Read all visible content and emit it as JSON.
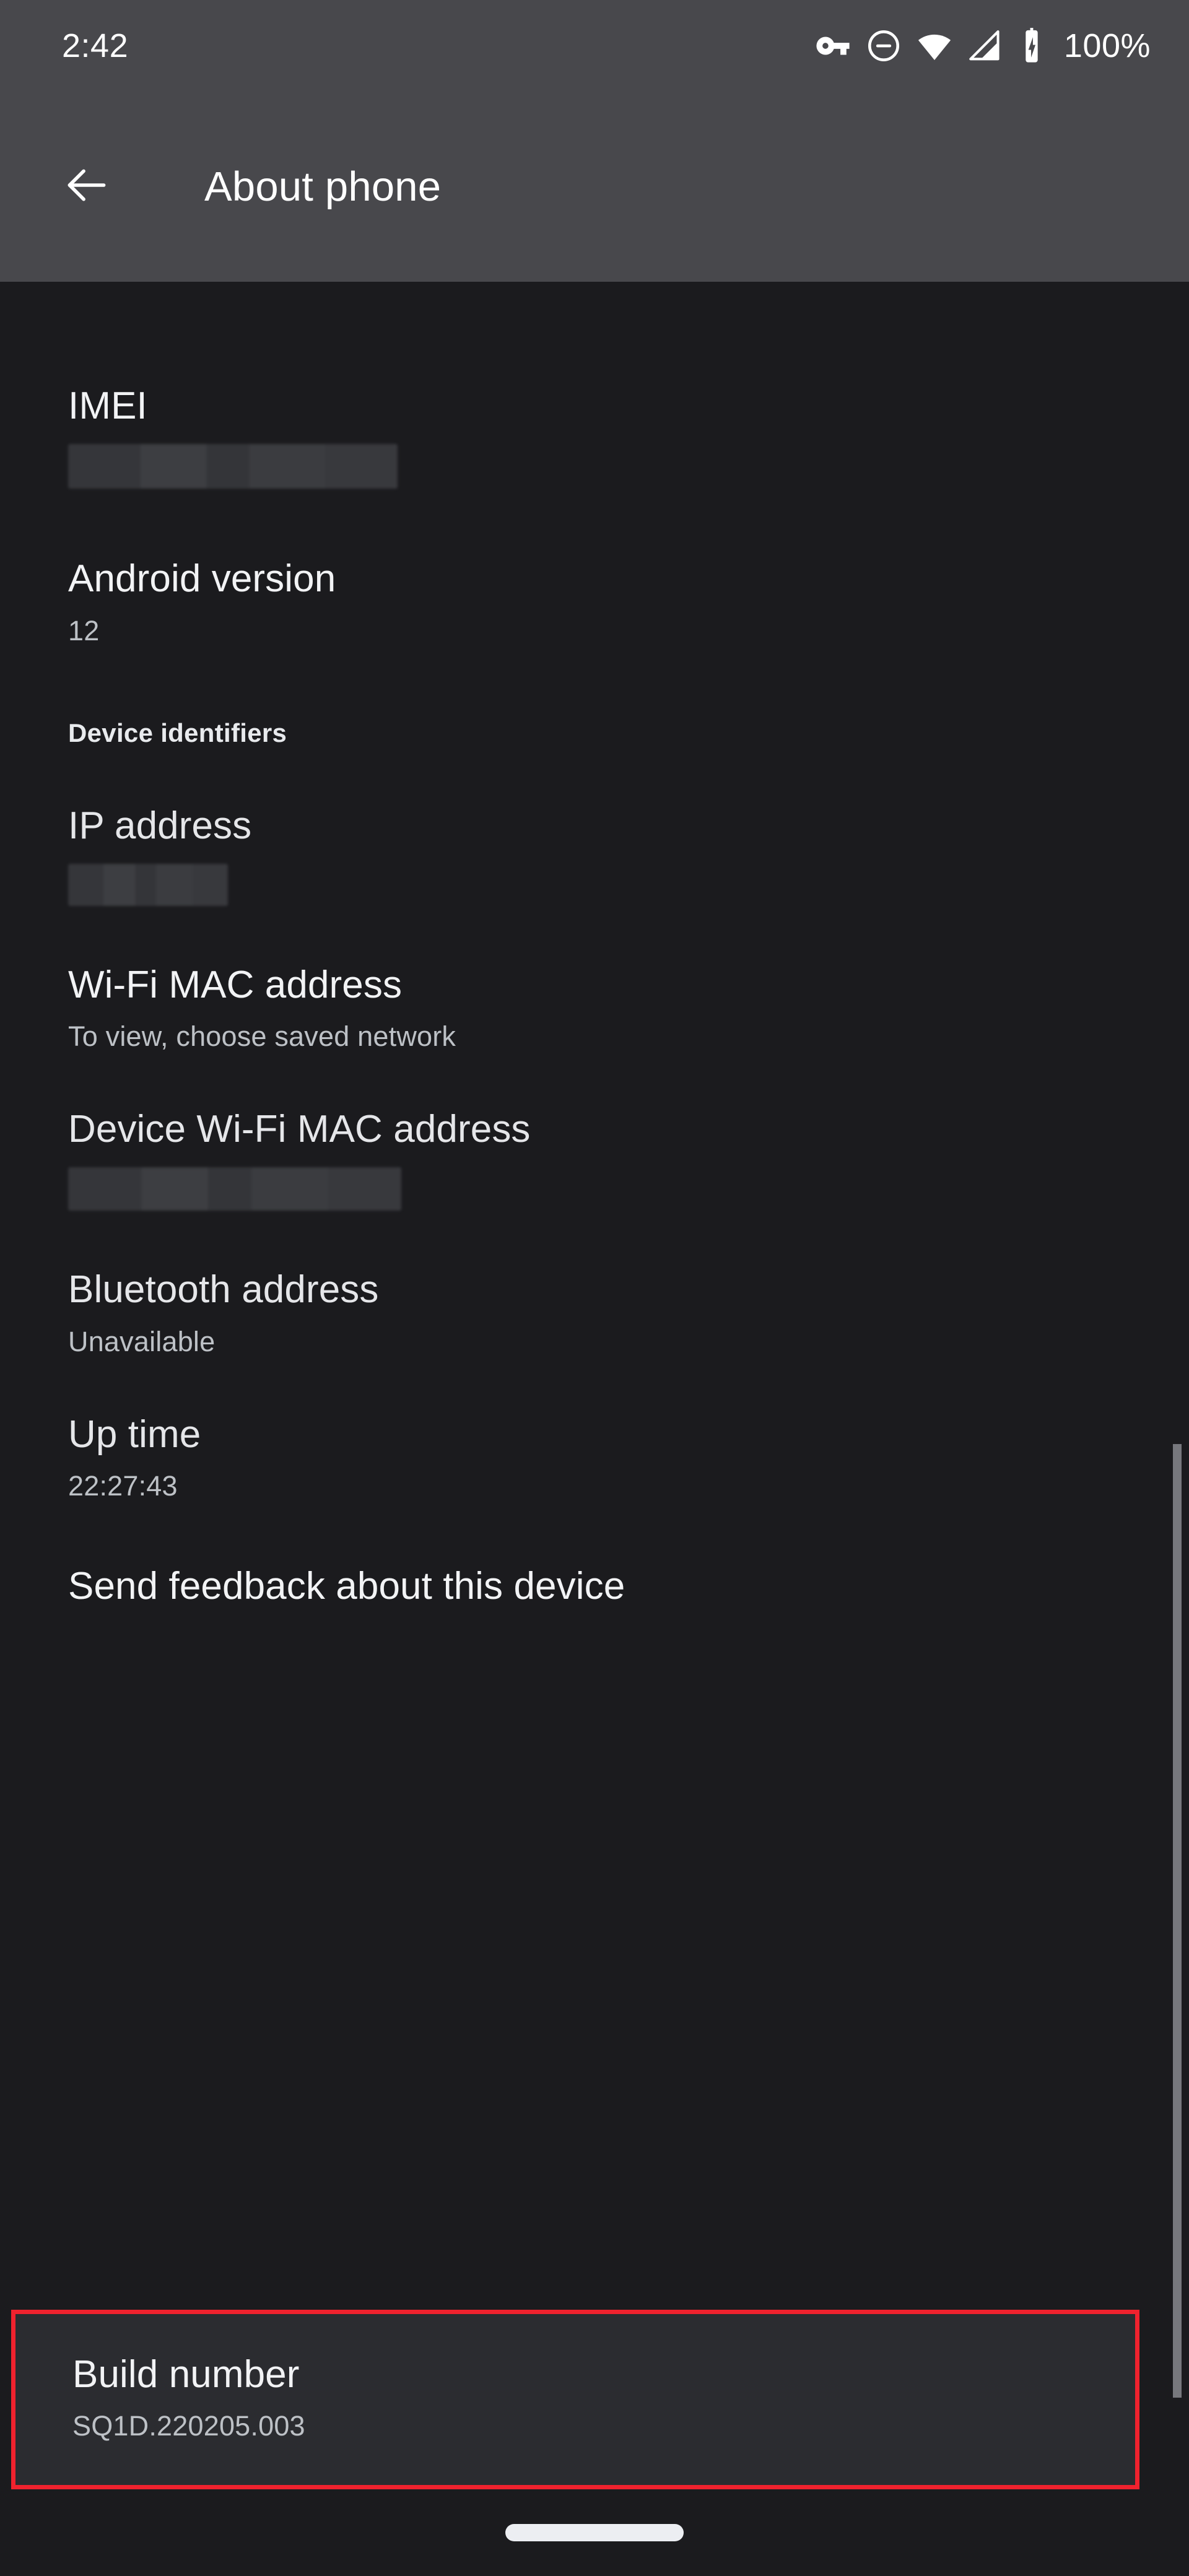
{
  "status_bar": {
    "time": "2:42",
    "battery_percent": "100%",
    "icons": [
      "vpn-key-icon",
      "do-not-disturb-icon",
      "wifi-icon",
      "cellular-signal-icon",
      "battery-charging-icon"
    ]
  },
  "app_bar": {
    "title": "About phone",
    "back_icon": "arrow-back-icon"
  },
  "settings": {
    "imei": {
      "title": "IMEI",
      "value": ""
    },
    "android_version": {
      "title": "Android version",
      "value": "12"
    },
    "device_identifiers_header": "Device identifiers",
    "ip_address": {
      "title": "IP address",
      "value": ""
    },
    "wifi_mac_address": {
      "title": "Wi-Fi MAC address",
      "value": "To view, choose saved network"
    },
    "device_wifi_mac_address": {
      "title": "Device Wi-Fi MAC address",
      "value": ""
    },
    "bluetooth_address": {
      "title": "Bluetooth address",
      "value": "Unavailable"
    },
    "up_time": {
      "title": "Up time",
      "value": "22:27:43"
    },
    "send_feedback": {
      "title": "Send feedback about this device"
    },
    "build_number": {
      "title": "Build number",
      "value": "SQ1D.220205.003"
    }
  },
  "colors": {
    "appbar_background": "#48484c",
    "content_background": "#1b1b1e",
    "highlight_border": "#f0222e",
    "highlight_fill": "#2b2c30",
    "primary_text": "#e5e6e9",
    "secondary_text": "#bdc1c6",
    "scrollbar": "#77787d",
    "nav_pill": "#eceef2"
  },
  "navigation_bar": {
    "gesture_pill": "home-gesture-pill"
  }
}
